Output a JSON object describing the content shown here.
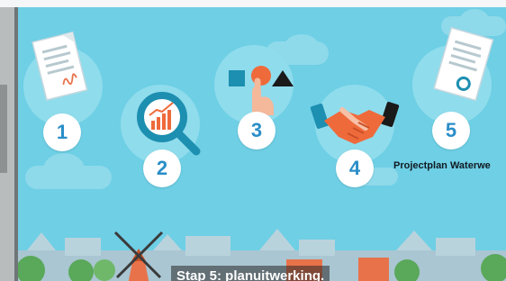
{
  "video": {
    "steps": [
      {
        "number": "1",
        "icon": "document-signature-icon"
      },
      {
        "number": "2",
        "icon": "magnifier-chart-icon"
      },
      {
        "number": "3",
        "icon": "shapes-hand-icon"
      },
      {
        "number": "4",
        "icon": "handshake-icon"
      },
      {
        "number": "5",
        "icon": "document-seal-icon"
      }
    ],
    "project_label": "Projectplan Waterwe",
    "subtitle": "Stap 5: planuitwerking."
  },
  "colors": {
    "sky": "#6ecfe5",
    "bubble": "#8fdcec",
    "number_text": "#2a8ec8",
    "accent_orange": "#ef6a3b",
    "accent_teal": "#1d8fb0"
  }
}
